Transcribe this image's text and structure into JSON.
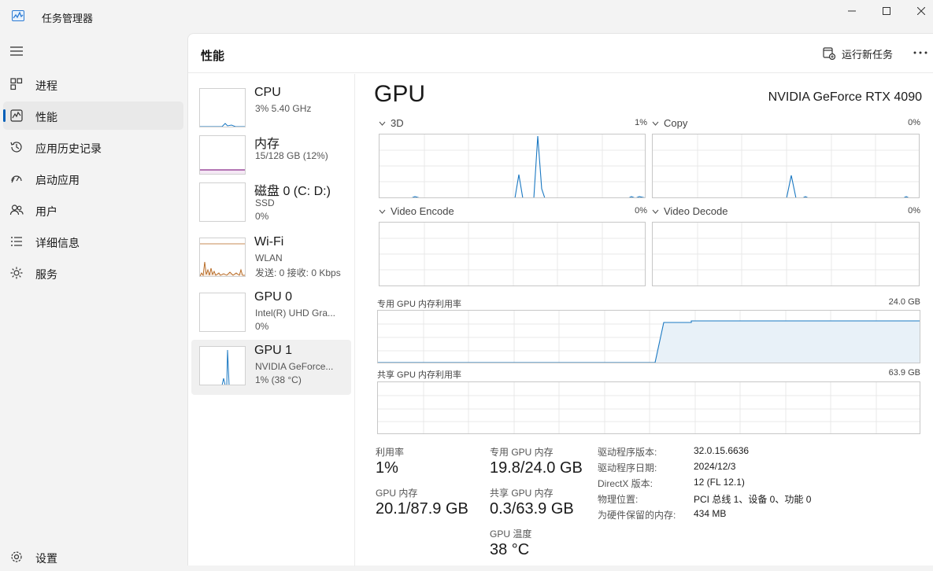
{
  "app": {
    "title": "任务管理器"
  },
  "sidebar": {
    "items": [
      {
        "label": "进程",
        "icon": "processes-icon"
      },
      {
        "label": "性能",
        "icon": "performance-icon",
        "active": true
      },
      {
        "label": "应用历史记录",
        "icon": "app-history-icon"
      },
      {
        "label": "启动应用",
        "icon": "startup-apps-icon"
      },
      {
        "label": "用户",
        "icon": "users-icon"
      },
      {
        "label": "详细信息",
        "icon": "details-icon"
      },
      {
        "label": "服务",
        "icon": "services-icon"
      }
    ],
    "settings_label": "设置"
  },
  "header": {
    "title": "性能",
    "run_task_label": "运行新任务"
  },
  "devices": [
    {
      "name": "CPU",
      "sub1": "3%  5.40 GHz",
      "sub2": ""
    },
    {
      "name": "内存",
      "sub1": "15/128 GB (12%)",
      "sub2": ""
    },
    {
      "name": "磁盘 0 (C: D:)",
      "sub1": "SSD",
      "sub2": "0%"
    },
    {
      "name": "Wi-Fi",
      "sub1": "WLAN",
      "sub2": "发送: 0  接收: 0 Kbps"
    },
    {
      "name": "GPU 0",
      "sub1": "Intel(R) UHD Gra...",
      "sub2": "0%"
    },
    {
      "name": "GPU 1",
      "sub1": "NVIDIA GeForce...",
      "sub2": "1% (38 °C)",
      "active": true
    }
  ],
  "gpu": {
    "title": "GPU",
    "model": "NVIDIA GeForce RTX 4090",
    "engines": [
      {
        "label": "3D",
        "pct": "1%"
      },
      {
        "label": "Copy",
        "pct": "0%"
      },
      {
        "label": "Video Encode",
        "pct": "0%"
      },
      {
        "label": "Video Decode",
        "pct": "0%"
      }
    ],
    "dedicated_mem": {
      "label": "专用 GPU 内存利用率",
      "max": "24.0 GB"
    },
    "shared_mem": {
      "label": "共享 GPU 内存利用率",
      "max": "63.9 GB"
    },
    "stats": {
      "utilization_label": "利用率",
      "utilization": "1%",
      "dedicated_label": "专用 GPU 内存",
      "dedicated": "19.8/24.0 GB",
      "gpu_mem_label": "GPU 内存",
      "gpu_mem": "20.1/87.9 GB",
      "shared_label": "共享 GPU 内存",
      "shared": "0.3/63.9 GB",
      "temp_label": "GPU 温度",
      "temp": "38 °C"
    },
    "info": [
      {
        "key": "驱动程序版本:",
        "value": "32.0.15.6636"
      },
      {
        "key": "驱动程序日期:",
        "value": "2024/12/3"
      },
      {
        "key": "DirectX 版本:",
        "value": "12 (FL 12.1)"
      },
      {
        "key": "物理位置:",
        "value": "PCI 总线 1、设备 0、功能 0"
      },
      {
        "key": "为硬件保留的内存:",
        "value": "434 MB"
      }
    ]
  },
  "colors": {
    "accent": "#005fb8",
    "graph_line": "#1a78c2",
    "memory_line": "#8b2a8b",
    "wifi_line": "#b5651d"
  }
}
